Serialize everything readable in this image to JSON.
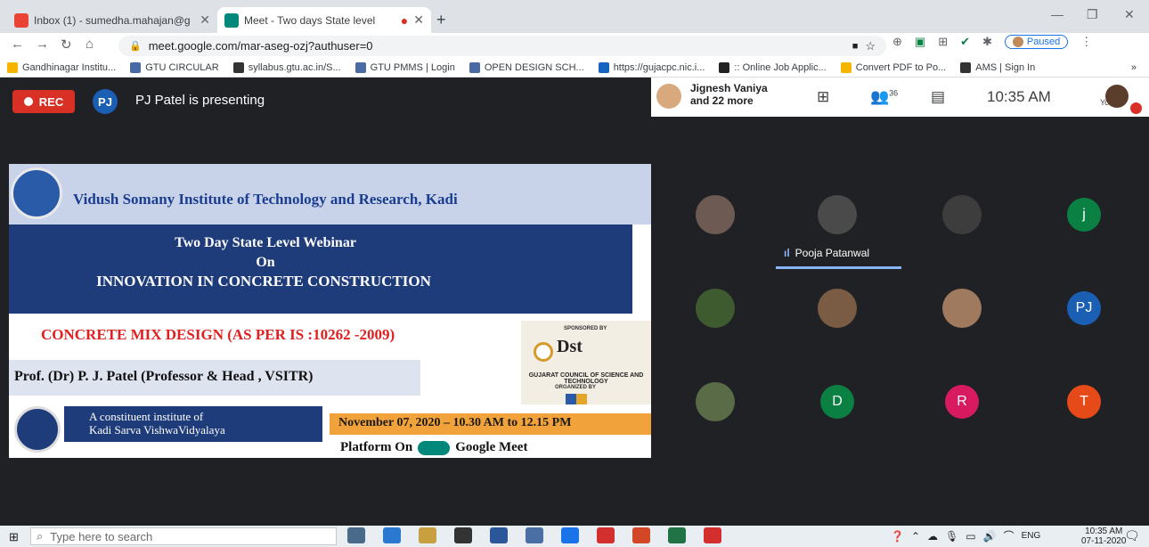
{
  "browser": {
    "tabs": [
      {
        "title": "Inbox (1) - sumedha.mahajan@g",
        "favicon_color": "#ea4335",
        "active": false
      },
      {
        "title": "Meet - Two days State level",
        "favicon_color": "#00897b",
        "active": true
      }
    ],
    "new_tab": "+",
    "url": "meet.google.com/mar-aseg-ozj?authuser=0",
    "profile_status": "Paused",
    "bookmarks": [
      {
        "label": "Gandhinagar Institu...",
        "color": "#f4b400"
      },
      {
        "label": "GTU CIRCULAR",
        "color": "#4a6aa5"
      },
      {
        "label": "syllabus.gtu.ac.in/S...",
        "color": "#333333"
      },
      {
        "label": "GTU PMMS | Login",
        "color": "#4a6aa5"
      },
      {
        "label": "OPEN DESIGN SCH...",
        "color": "#4a6aa5"
      },
      {
        "label": "https://gujacpc.nic.i...",
        "color": "#1565c0"
      },
      {
        "label": ":: Online Job Applic...",
        "color": "#222222"
      },
      {
        "label": "Convert PDF to Po...",
        "color": "#f4b400"
      },
      {
        "label": "AMS | Sign In",
        "color": "#333333"
      }
    ],
    "bookmarks_more": "»"
  },
  "meet": {
    "rec_label": "REC",
    "presenter_initials": "PJ",
    "presenting_text": "PJ Patel is presenting",
    "participants_line1": "Jignesh Vaniya",
    "participants_line2": "and 22 more",
    "participant_count": "36",
    "time": "10:35 AM",
    "you_label": "You",
    "speaker_name": "Pooja Patanwal",
    "tiles": [
      {
        "type": "photo",
        "color": "#6d5a52"
      },
      {
        "type": "photo",
        "color": "#4a4a4a"
      },
      {
        "type": "photo",
        "color": "#3d3d3d"
      },
      {
        "type": "letter",
        "letter": "j",
        "color": "#0b8043"
      },
      {
        "type": "photo",
        "color": "#3e5b2f"
      },
      {
        "type": "photo",
        "color": "#7a5b44"
      },
      {
        "type": "photo",
        "color": "#a07a5e"
      },
      {
        "type": "letter",
        "letter": "PJ",
        "color": "#1a5fb4"
      },
      {
        "type": "photo",
        "color": "#5a6b48"
      },
      {
        "type": "letter",
        "letter": "D",
        "color": "#0b8043"
      },
      {
        "type": "letter",
        "letter": "R",
        "color": "#d81b60"
      },
      {
        "type": "letter",
        "letter": "T",
        "color": "#e64a19"
      }
    ]
  },
  "slide": {
    "institute": "Vidush Somany Institute of Technology and Research, Kadi",
    "line1": "Two Day State Level Webinar",
    "line2": "On",
    "line3": "INNOVATION IN CONCRETE CONSTRUCTION",
    "mix_design": "CONCRETE MIX DESIGN (AS PER IS :10262 -2009)",
    "professor": "Prof. (Dr) P. J. Patel (Professor & Head , VSITR)",
    "sponsored_by": "SPONSORED BY",
    "dst": "Dst",
    "gcst": "GUJARAT COUNCIL OF SCIENCE AND TECHNOLOGY",
    "organized_by": "ORGANIZED BY",
    "constituent_line1": "A constituent institute of",
    "constituent_line2": "Kadi Sarva VishwaVidyalaya",
    "date": "November 07, 2020 – 10.30 AM to 12.15 PM",
    "platform_prefix": "Platform On",
    "platform_suffix": "Google Meet"
  },
  "taskbar": {
    "search_placeholder": "Type here to search",
    "apps": [
      "#4a6a8a",
      "#2b78d1",
      "#c8a040",
      "#333333",
      "#2b579a",
      "#4a6fa5",
      "#1a73e8",
      "#d32f2f",
      "#d24726",
      "#217346",
      "#d32f2f"
    ],
    "lang": "ENG",
    "time": "10:35 AM",
    "date": "07-11-2020"
  }
}
